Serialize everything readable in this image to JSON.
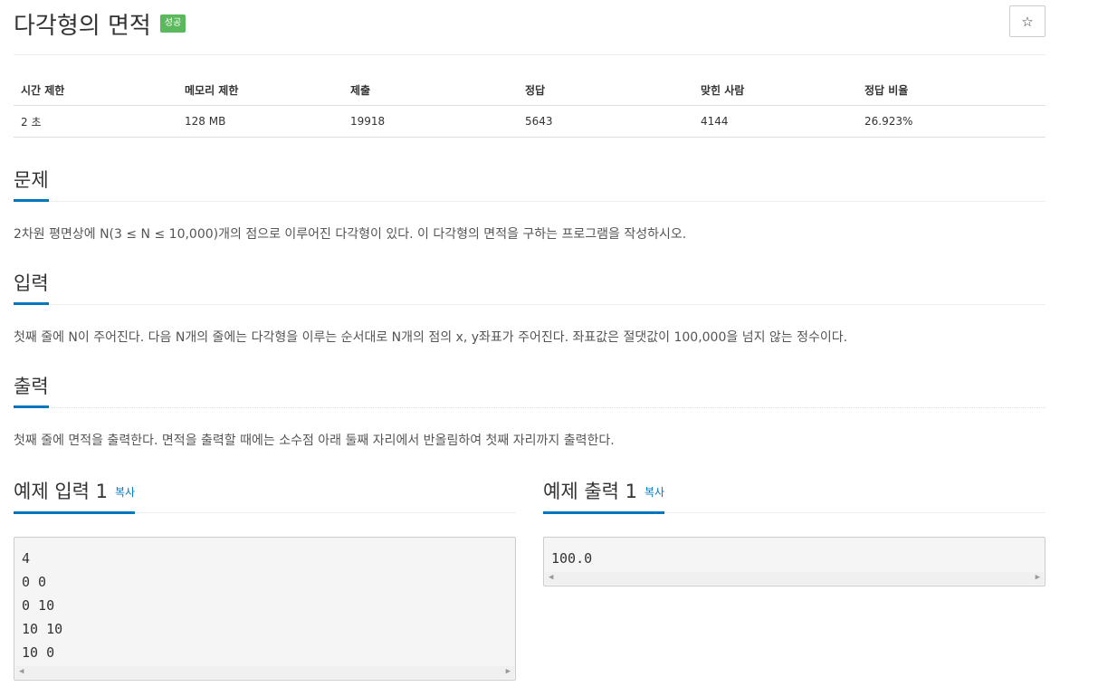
{
  "problem": {
    "title": "다각형의 면적",
    "badge": "성공",
    "star_icon": "☆"
  },
  "info_table": {
    "headers": [
      "시간 제한",
      "메모리 제한",
      "제출",
      "정답",
      "맞힌 사람",
      "정답 비율"
    ],
    "values": [
      "2 초",
      "128 MB",
      "19918",
      "5643",
      "4144",
      "26.923%"
    ]
  },
  "sections": {
    "problem": {
      "heading": "문제",
      "text": "2차원 평면상에 N(3 ≤ N ≤ 10,000)개의 점으로 이루어진 다각형이 있다. 이 다각형의 면적을 구하는 프로그램을 작성하시오."
    },
    "input": {
      "heading": "입력",
      "text": "첫째 줄에 N이 주어진다. 다음 N개의 줄에는 다각형을 이루는 순서대로 N개의 점의 x, y좌표가 주어진다. 좌표값은 절댓값이 100,000을 넘지 않는 정수이다."
    },
    "output": {
      "heading": "출력",
      "text": "첫째 줄에 면적을 출력한다. 면적을 출력할 때에는 소수점 아래 둘째 자리에서 반올림하여 첫째 자리까지 출력한다."
    }
  },
  "samples": {
    "input": {
      "heading": "예제 입력 1",
      "copy": "복사",
      "lines": [
        "4",
        "0 0",
        "0 10",
        "10 10",
        "10 0"
      ]
    },
    "output": {
      "heading": "예제 출력 1",
      "copy": "복사",
      "lines": [
        "100.0"
      ]
    }
  },
  "colors": {
    "accent": "#0076c0",
    "badge_success": "#5cb85c"
  }
}
